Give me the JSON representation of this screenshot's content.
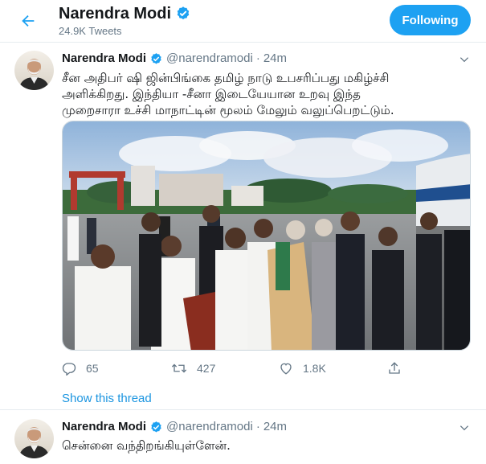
{
  "header": {
    "title": "Narendra Modi",
    "tweet_count": "24.9K Tweets",
    "follow_label": "Following"
  },
  "tweets": [
    {
      "name": "Narendra Modi",
      "handle": "@narendramodi",
      "dot": "·",
      "time": "24m",
      "text_lines": [
        "சீன அதிபர் ஷி ஜின்பிங்கை தமிழ் நாடு உபசரிப்பது மகிழ்ச்சி",
        "அளிக்கிறது.  இந்தியா -சீனா இடையேயான உறவு இந்த",
        "முறைசாரா உச்சி மாநாட்டின் மூலம் மேலும் வலுப்பெறட்டும்."
      ],
      "photo": "tarmac-welcome-photo",
      "actions": {
        "reply_count": "65",
        "retweet_count": "427",
        "like_count": "1.8K"
      },
      "show_thread": "Show this thread"
    },
    {
      "name": "Narendra Modi",
      "handle": "@narendramodi",
      "dot": "·",
      "time": "24m",
      "text_lines": [
        "சென்னை வந்திறங்கியுள்ளேன்."
      ]
    }
  ],
  "colors": {
    "accent": "#1da1f2",
    "link": "#1b95e0",
    "muted": "#657786",
    "text": "#14171a",
    "divider": "#e6ecf0"
  },
  "icons": [
    "back-arrow-icon",
    "verified-badge-icon",
    "chevron-down-icon",
    "reply-icon",
    "retweet-icon",
    "like-icon",
    "share-icon"
  ]
}
